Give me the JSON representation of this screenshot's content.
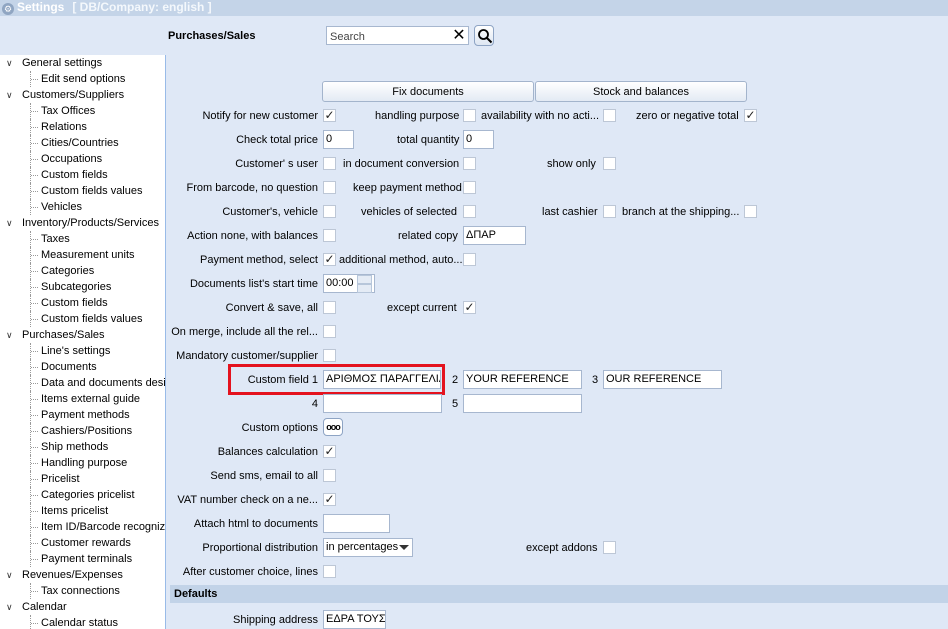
{
  "window": {
    "title": "Settings",
    "subtitle": "[ DB/Company: english ]"
  },
  "topbar": {
    "heading": "Purchases/Sales",
    "search_placeholder": "Search"
  },
  "sidebar": {
    "items": [
      {
        "label": "General settings",
        "type": "parent"
      },
      {
        "label": "Edit send options",
        "type": "child"
      },
      {
        "label": "Customers/Suppliers",
        "type": "parent"
      },
      {
        "label": "Tax Offices",
        "type": "child"
      },
      {
        "label": "Relations",
        "type": "child"
      },
      {
        "label": "Cities/Countries",
        "type": "child"
      },
      {
        "label": "Occupations",
        "type": "child"
      },
      {
        "label": "Custom fields",
        "type": "child"
      },
      {
        "label": "Custom fields values",
        "type": "child"
      },
      {
        "label": "Vehicles",
        "type": "child"
      },
      {
        "label": "Inventory/Products/Services",
        "type": "parent"
      },
      {
        "label": "Taxes",
        "type": "child"
      },
      {
        "label": "Measurement units",
        "type": "child"
      },
      {
        "label": "Categories",
        "type": "child"
      },
      {
        "label": "Subcategories",
        "type": "child"
      },
      {
        "label": "Custom fields",
        "type": "child"
      },
      {
        "label": "Custom fields values",
        "type": "child"
      },
      {
        "label": "Purchases/Sales",
        "type": "parent"
      },
      {
        "label": "Line's settings",
        "type": "child"
      },
      {
        "label": "Documents",
        "type": "child"
      },
      {
        "label": "Data and documents desi",
        "type": "child"
      },
      {
        "label": "Items external guide",
        "type": "child"
      },
      {
        "label": "Payment methods",
        "type": "child"
      },
      {
        "label": "Cashiers/Positions",
        "type": "child"
      },
      {
        "label": "Ship methods",
        "type": "child"
      },
      {
        "label": "Handling purpose",
        "type": "child"
      },
      {
        "label": "Pricelist",
        "type": "child"
      },
      {
        "label": "Categories pricelist",
        "type": "child"
      },
      {
        "label": "Items pricelist",
        "type": "child"
      },
      {
        "label": "Item ID/Barcode recognize",
        "type": "child"
      },
      {
        "label": "Customer rewards",
        "type": "child"
      },
      {
        "label": "Payment terminals",
        "type": "child"
      },
      {
        "label": "Revenues/Expenses",
        "type": "parent"
      },
      {
        "label": "Tax connections",
        "type": "child"
      },
      {
        "label": "Calendar",
        "type": "parent"
      },
      {
        "label": "Calendar status",
        "type": "child"
      }
    ]
  },
  "buttons": {
    "fix_documents": "Fix documents",
    "stock_balances": "Stock and balances",
    "custom_options": "ooo"
  },
  "form": {
    "notify_new_customer": "Notify for new customer",
    "handling_purpose": "handling purpose",
    "availability_no_action": "availability with no acti...",
    "zero_negative_total": "zero or negative total",
    "check_total_price": "Check total price",
    "check_total_price_value": "0",
    "total_quantity": "total quantity",
    "total_quantity_value": "0",
    "customers_user": "Customer' s user",
    "in_document_conversion": "in document conversion",
    "show_only": "show only",
    "from_barcode": "From barcode, no question",
    "keep_payment_method": "keep payment method",
    "customers_vehicle": "Customer's, vehicle",
    "vehicles_of_selected": "vehicles of selected",
    "last_cashier": "last cashier",
    "branch_at_shipping": "branch at the shipping...",
    "action_none_balances": "Action none, with balances",
    "related_copy": "related copy",
    "related_copy_value": "ΔΠΑΡ",
    "payment_method_select": "Payment method, select",
    "additional_method": "additional method, auto...",
    "documents_list_start_time": "Documents list's start time",
    "documents_list_start_time_value": "00:00",
    "convert_save_all": "Convert & save, all",
    "except_current": "except current",
    "on_merge_include": "On merge, include all the rel...",
    "mandatory_customer": "Mandatory customer/supplier",
    "custom_field_1": "Custom field 1",
    "custom_field_1_value": "ΑΡΙΘΜΟΣ ΠΑΡΑΓΓΕΛΙΑΣ",
    "n2": "2",
    "custom_field_2_value": "YOUR REFERENCE",
    "n3": "3",
    "custom_field_3_value": "OUR REFERENCE",
    "n4": "4",
    "n5": "5",
    "custom_options": "Custom options",
    "balances_calculation": "Balances calculation",
    "send_sms_email": "Send sms, email to all",
    "vat_number_check": "VAT number check on a ne...",
    "attach_html": "Attach html to documents",
    "proportional_distribution": "Proportional distribution",
    "proportional_distribution_value": "in percentages",
    "except_addons": "except addons",
    "after_customer_choice": "After customer choice, lines",
    "defaults": "Defaults",
    "shipping_address": "Shipping address",
    "shipping_address_value": "ΕΔΡΑ ΤΟΥΣ"
  },
  "checks": {
    "notify_new_customer": true,
    "handling_purpose": false,
    "availability_no_action": false,
    "zero_negative_total": true,
    "customers_user": false,
    "in_document_conversion": false,
    "show_only": false,
    "from_barcode": false,
    "keep_payment_method": false,
    "customers_vehicle": false,
    "vehicles_of_selected": false,
    "last_cashier": false,
    "branch_at_shipping": false,
    "action_none_balances": false,
    "payment_method_select": true,
    "additional_method": false,
    "convert_save_all": false,
    "except_current": true,
    "on_merge_include": false,
    "mandatory_customer": false,
    "balances_calculation": true,
    "send_sms_email": false,
    "vat_number_check": true,
    "except_addons": false,
    "after_customer_choice": false
  },
  "colors": {
    "background": "#dfe8f6",
    "highlight": "#e4121e",
    "section_bar": "#c2d3e8"
  }
}
